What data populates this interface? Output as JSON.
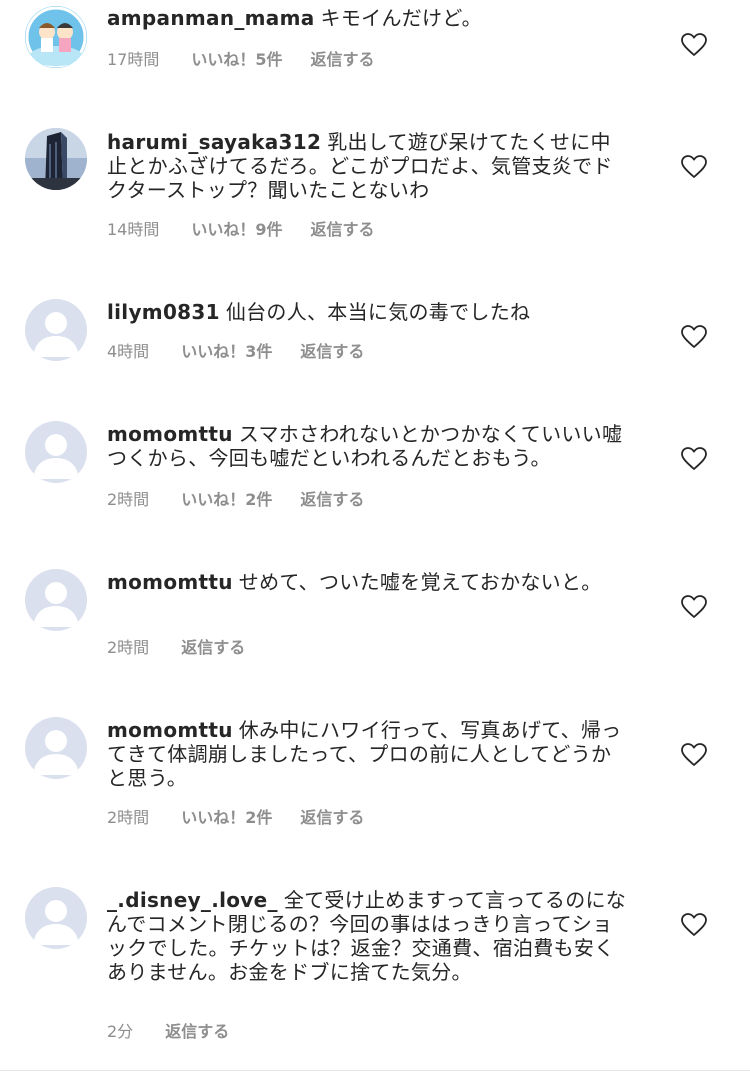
{
  "comments": [
    {
      "username": "ampanman_mama",
      "text": "キモイんだけど。",
      "time": "17時間",
      "likes": "いいね！5件",
      "reply": "返信する",
      "avatar": "photo-cartoon"
    },
    {
      "username": "harumi_sayaka312",
      "text": "乳出して遊び呆けてたくせに中止とかふざけてるだろ。どこがプロだよ、気管支炎でドクターストップ？聞いたことないわ",
      "time": "14時間",
      "likes": "いいね！9件",
      "reply": "返信する",
      "avatar": "photo-building"
    },
    {
      "username": "lilym0831",
      "text": "仙台の人、本当に気の毒でしたね",
      "time": "4時間",
      "likes": "いいね！3件",
      "reply": "返信する",
      "avatar": "default-user"
    },
    {
      "username": "momomttu",
      "text": "スマホさわれないとかつかなくていいい嘘つくから、今回も嘘だといわれるんだとおもう。",
      "time": "2時間",
      "likes": "いいね！2件",
      "reply": "返信する",
      "avatar": "default-user"
    },
    {
      "username": "momomttu",
      "text": "せめて、ついた嘘を覚えておかないと。",
      "time": "2時間",
      "likes": "",
      "reply": "返信する",
      "avatar": "default-user"
    },
    {
      "username": "momomttu",
      "text": "休み中にハワイ行って、写真あげて、帰ってきて体調崩しましたって、プロの前に人としてどうかと思う。",
      "time": "2時間",
      "likes": "いいね！2件",
      "reply": "返信する",
      "avatar": "default-user"
    },
    {
      "username": "_.disney_.love_",
      "text": "全て受け止めますって言ってるのになんでコメント閉じるの？今回の事ははっきり言ってショックでした。チケットは？返金？交通費、宿泊費も安くありません。お金をドブに捨てた気分。",
      "time": "2分",
      "likes": "",
      "reply": "返信する",
      "avatar": "default-user"
    }
  ],
  "icons": {
    "like": "heart-outline-icon",
    "default_avatar": "user-silhouette-icon"
  },
  "colors": {
    "text": "#262626",
    "secondary": "#8e8e8e",
    "avatar_bg": "#dbe0ee",
    "avatar_fg": "#ffffff"
  }
}
